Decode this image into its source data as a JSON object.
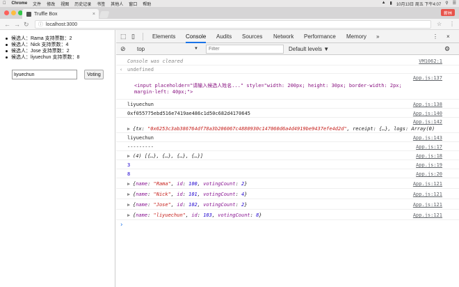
{
  "menubar": {
    "app_name": "Chrome",
    "items": [
      "文件",
      "修改",
      "视图",
      "历史记录",
      "书签",
      "其他人",
      "窗口",
      "帮助"
    ],
    "status": "10月13日 周五 下午4:07"
  },
  "browser": {
    "tab_title": "Truffle Box",
    "url": "localhost:3000",
    "profile_label": "薪林"
  },
  "page": {
    "candidates": [
      "候选人：Rama 支持票数：2",
      "候选人：Nick 支持票数：4",
      "候选人：Jose 支持票数：2",
      "候选人：liyuechun 支持票数：8"
    ],
    "input_value": "liyuechun",
    "vote_button": "Voting"
  },
  "devtools": {
    "tabs": [
      "Elements",
      "Console",
      "Audits",
      "Sources",
      "Network",
      "Performance",
      "Memory"
    ],
    "active_tab": "Console",
    "more": "»",
    "context": "top",
    "filter_placeholder": "Filter",
    "levels": "Default levels ▼"
  },
  "console": {
    "cleared": "Console was cleared",
    "cleared_src": "VM1062:1",
    "undefined": "undefined",
    "html_src": "App.js:137",
    "html_line1": "<input placeholder=\"请输入候选人姓名...\" style=\"width: 200px; height: 30px; border-width: 2px;",
    "html_line2": "margin-left: 40px;\">",
    "name1": "liyuechun",
    "name1_src": "App.js:138",
    "address": "0xf055775ebd516e7419ae486c1d50c682d4170645",
    "address_src": "App.js:140",
    "tx_src": "App.js:142",
    "tx_prefix": "{tx: ",
    "tx_hash": "\"0x6253c3ab386764df78a3b206067c4880930c147060d6a4d4919be9437efe4d2d\"",
    "tx_suffix": ", receipt: {…}, logs: Array(0)",
    "name2": "liyuechun",
    "name2_src": "App.js:143",
    "dashes": "---------",
    "dashes_src": "App.js:17",
    "array_text": "(4) [{…}, {…}, {…}, {…}]",
    "array_src": "App.js:18",
    "num3": "3",
    "num3_src": "App.js:19",
    "num8": "8",
    "num8_src": "App.js:20",
    "objects": [
      {
        "name": "\"Rama\"",
        "id": "100",
        "votingCount": "2",
        "src": "App.js:121"
      },
      {
        "name": "\"Nick\"",
        "id": "101",
        "votingCount": "4",
        "src": "App.js:121"
      },
      {
        "name": "\"Jose\"",
        "id": "102",
        "votingCount": "2",
        "src": "App.js:121"
      },
      {
        "name": "\"liyuechun\"",
        "id": "103",
        "votingCount": "8",
        "src": "App.js:121"
      }
    ],
    "prompt": "›"
  },
  "colors": {
    "accent": "#1a73e8",
    "string": "#c41a16",
    "number": "#1c00cf",
    "key": "#881391"
  }
}
